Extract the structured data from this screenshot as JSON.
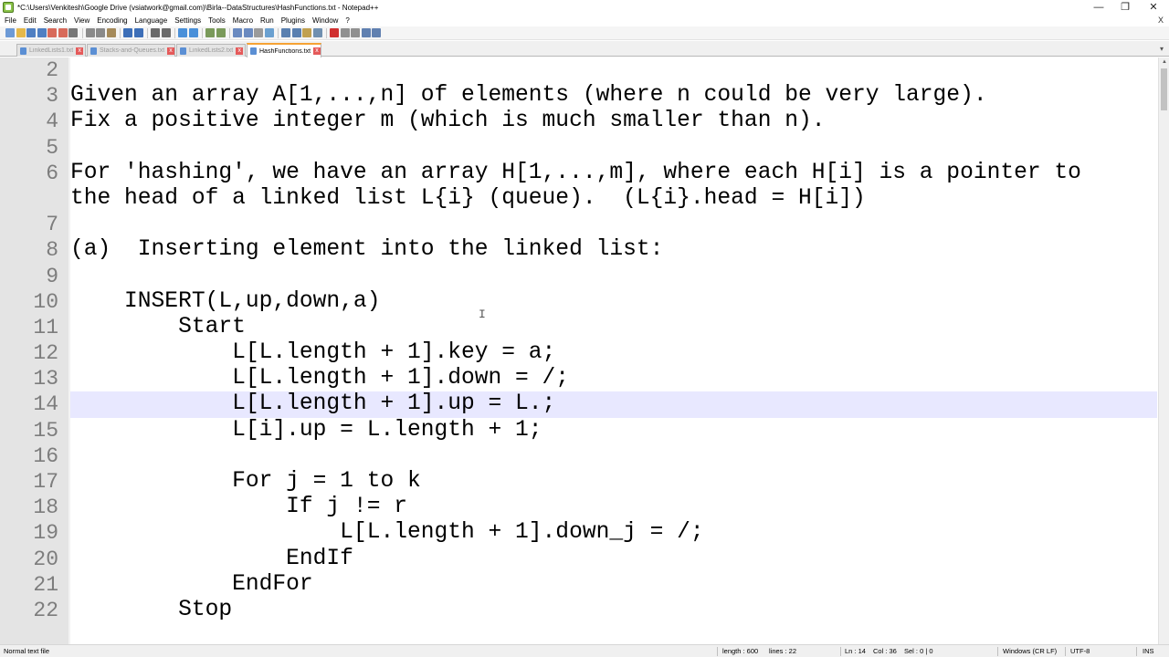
{
  "window": {
    "title": "*C:\\Users\\Venkitesh\\Google Drive (vsiatwork@gmail.com)\\Birla--DataStructures\\HashFunctions.txt - Notepad++",
    "minimize": "—",
    "maximize": "❐",
    "close": "✕"
  },
  "menu": {
    "items": [
      "File",
      "Edit",
      "Search",
      "View",
      "Encoding",
      "Language",
      "Settings",
      "Tools",
      "Macro",
      "Run",
      "Plugins",
      "Window",
      "?"
    ],
    "close_glyph": "X"
  },
  "toolbar": {
    "icons": [
      "new-file-icon",
      "open-file-icon",
      "save-icon",
      "save-all-icon",
      "close-icon",
      "close-all-icon",
      "print-icon",
      "cut-icon",
      "copy-icon",
      "paste-icon",
      "undo-icon",
      "redo-icon",
      "find-icon",
      "replace-icon",
      "zoom-in-icon",
      "zoom-out-icon",
      "sync-v-icon",
      "sync-h-icon",
      "word-wrap-icon",
      "show-all-chars-icon",
      "indent-guide-icon",
      "udl-icon",
      "doc-map-icon",
      "function-list-icon",
      "folder-workspace-icon",
      "monitor-icon",
      "record-macro-icon",
      "stop-macro-icon",
      "play-macro-icon",
      "run-macro-multiple-icon",
      "save-macro-icon"
    ]
  },
  "tabs": [
    {
      "label": "LinkedLists1.txt",
      "active": false
    },
    {
      "label": "Stacks-and-Queues.txt",
      "active": false
    },
    {
      "label": "LinkedLists2.txt",
      "active": false
    },
    {
      "label": "HashFunctions.txt",
      "active": true
    }
  ],
  "tab_close_glyph": "x",
  "tab_list_glyph": "▾",
  "editor": {
    "current_line": 14,
    "lines": [
      {
        "n": "2",
        "text": ""
      },
      {
        "n": "3",
        "text": "Given an array A[1,...,n] of elements (where n could be very large)."
      },
      {
        "n": "4",
        "text": "Fix a positive integer m (which is much smaller than n)."
      },
      {
        "n": "5",
        "text": ""
      },
      {
        "n": "6",
        "text": "For 'hashing', we have an array H[1,...,m], where each H[i] is a pointer to"
      },
      {
        "n": "",
        "text": "the head of a linked list L{i} (queue).  (L{i}.head = H[i])"
      },
      {
        "n": "7",
        "text": ""
      },
      {
        "n": "8",
        "text": "(a)  Inserting element into the linked list:"
      },
      {
        "n": "9",
        "text": ""
      },
      {
        "n": "10",
        "text": "    INSERT(L,up,down,a)"
      },
      {
        "n": "11",
        "text": "        Start"
      },
      {
        "n": "12",
        "text": "            L[L.length + 1].key = a;"
      },
      {
        "n": "13",
        "text": "            L[L.length + 1].down = /;"
      },
      {
        "n": "14",
        "text": "            L[L.length + 1].up = L.;"
      },
      {
        "n": "15",
        "text": "            L[i].up = L.length + 1;"
      },
      {
        "n": "16",
        "text": ""
      },
      {
        "n": "17",
        "text": "            For j = 1 to k"
      },
      {
        "n": "18",
        "text": "                If j != r"
      },
      {
        "n": "19",
        "text": "                    L[L.length + 1].down_j = /;"
      },
      {
        "n": "20",
        "text": "                EndIf"
      },
      {
        "n": "21",
        "text": "            EndFor"
      },
      {
        "n": "22",
        "text": "        Stop"
      }
    ]
  },
  "status": {
    "file_type": "Normal text file",
    "length": "length : 600",
    "lines": "lines : 22",
    "position": "Ln : 14",
    "column": "Col : 36",
    "selection": "Sel : 0 | 0",
    "eol": "Windows (CR LF)",
    "encoding": "UTF-8",
    "insert_mode": "INS"
  },
  "colors": {
    "current_line": "#e8e8ff",
    "gutter": "#e4e4e4",
    "line_number": "#7d7d7d",
    "active_tab_accent": "#f6a234"
  }
}
